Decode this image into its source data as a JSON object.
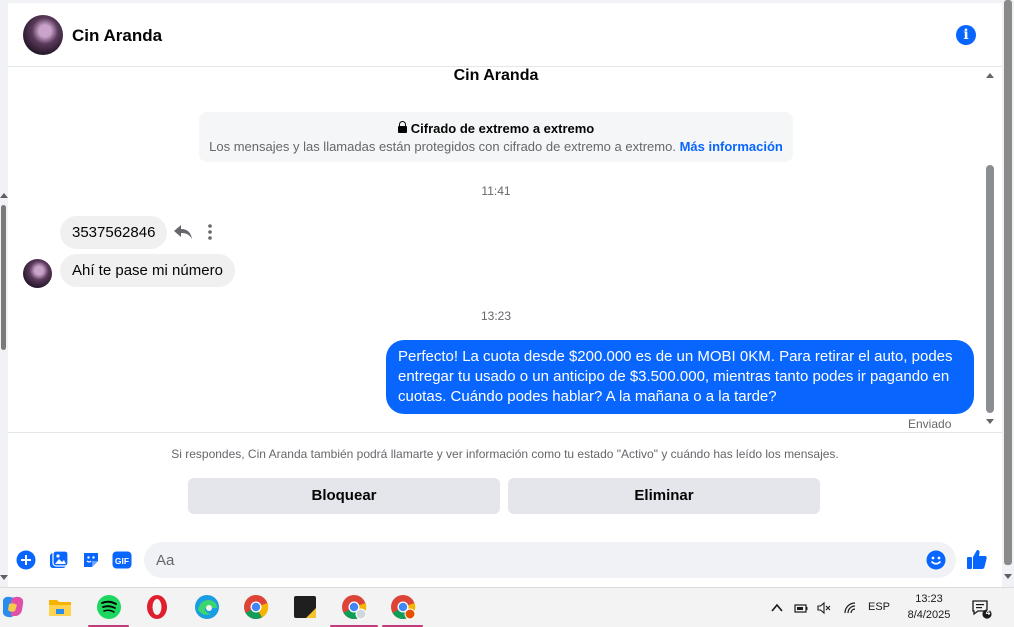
{
  "header": {
    "contact_name": "Cin Aranda"
  },
  "chat": {
    "title": "Cin Aranda",
    "encryption": {
      "title": "Cifrado de extremo a extremo",
      "text": "Los mensajes y las llamadas están protegidos con cifrado de extremo a extremo.",
      "link": "Más información"
    },
    "timestamp_1": "11:41",
    "incoming": [
      {
        "text": "3537562846"
      },
      {
        "text": "Ahí te pase mi número"
      }
    ],
    "timestamp_2": "13:23",
    "outgoing": {
      "text": "Perfecto! La cuota desde $200.000 es de un MOBI 0KM. Para retirar el auto, podes entregar tu usado o un anticipo de $3.500.000, mientras tanto podes ir pagando en cuotas. Cuándo podes hablar? A la mañana o a la tarde?"
    },
    "sent_status": "Enviado"
  },
  "notice": "Si respondes, Cin Aranda también podrá llamarte y ver información como tu estado \"Activo\" y cuándo has leído los mensajes.",
  "actions": {
    "block_label": "Bloquear",
    "delete_label": "Eliminar"
  },
  "composer": {
    "placeholder": "Aa"
  },
  "taskbar": {
    "apps": [
      "copilot-icon",
      "file-explorer-icon",
      "spotify-icon",
      "opera-icon",
      "edge-icon",
      "chrome-icon",
      "sticky-notes-icon",
      "chrome-profile-icon",
      "chrome-profile-2-icon"
    ],
    "language": "ESP",
    "time": "13:23",
    "date": "8/4/2025",
    "notification_count": "4"
  },
  "colors": {
    "accent": "#0866ff",
    "bubble_in": "#f0f0f0",
    "button_gray": "#e4e6eb"
  }
}
